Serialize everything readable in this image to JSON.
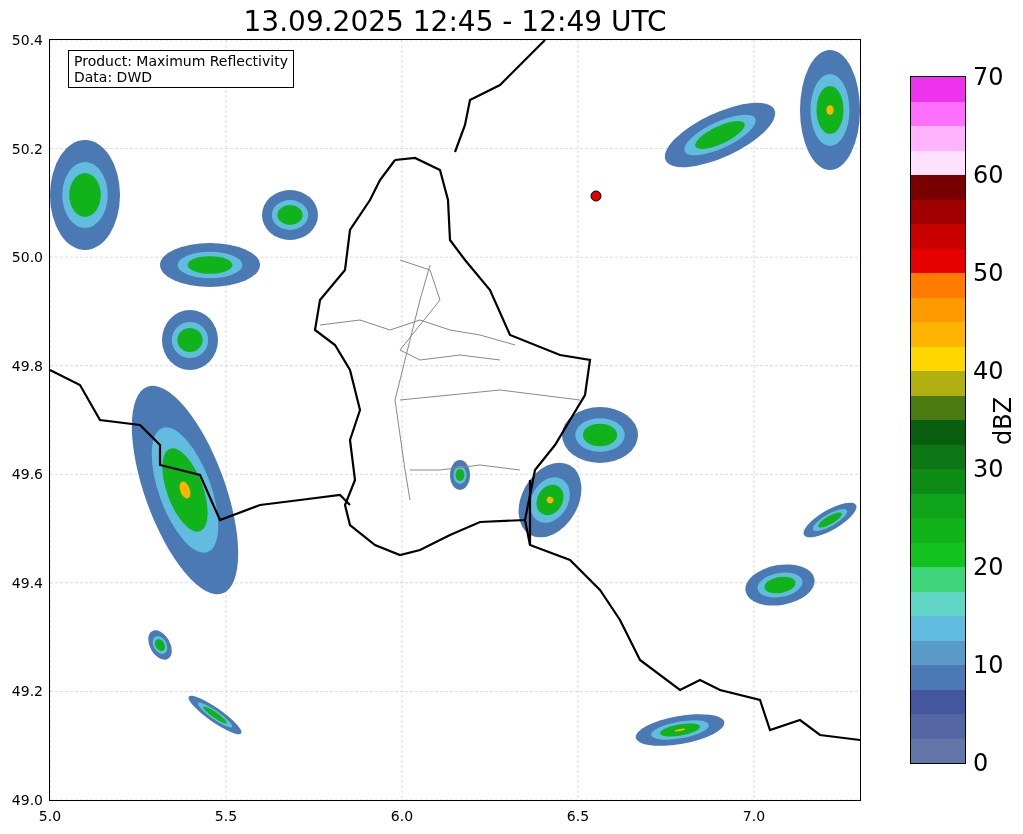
{
  "title": "13.09.2025 12:45 - 12:49 UTC",
  "legend": [
    "Product: Maximum Reflectivity",
    "Data: DWD"
  ],
  "xticks": [
    "5.0",
    "5.5",
    "6.0",
    "6.5",
    "7.0"
  ],
  "yticks": [
    "50.4",
    "50.2",
    "50.0",
    "49.8",
    "49.6",
    "49.4",
    "49.2",
    "49.0"
  ],
  "colorbar": {
    "label": "dBZ",
    "ticks": [
      "70",
      "60",
      "50",
      "40",
      "30",
      "20",
      "10",
      "0"
    ],
    "bins": [
      {
        "color": "#ee33ee"
      },
      {
        "color": "#ff70ff"
      },
      {
        "color": "#ffb4ff"
      },
      {
        "color": "#ffe0ff"
      },
      {
        "color": "#780000"
      },
      {
        "color": "#a00000"
      },
      {
        "color": "#c80000"
      },
      {
        "color": "#e60000"
      },
      {
        "color": "#ff7c00"
      },
      {
        "color": "#ff9a00"
      },
      {
        "color": "#ffb400"
      },
      {
        "color": "#ffd700"
      },
      {
        "color": "#b0b010"
      },
      {
        "color": "#4a7a10"
      },
      {
        "color": "#0a5e10"
      },
      {
        "color": "#0b7613"
      },
      {
        "color": "#0c8c15"
      },
      {
        "color": "#0ea319"
      },
      {
        "color": "#10b41a"
      },
      {
        "color": "#12c21e"
      },
      {
        "color": "#3ed479"
      },
      {
        "color": "#62d6c6"
      },
      {
        "color": "#62bce0"
      },
      {
        "color": "#5b9bc9"
      },
      {
        "color": "#4a79b3"
      },
      {
        "color": "#4456a0"
      },
      {
        "color": "#5566a3"
      },
      {
        "color": "#6475a7"
      }
    ]
  }
}
